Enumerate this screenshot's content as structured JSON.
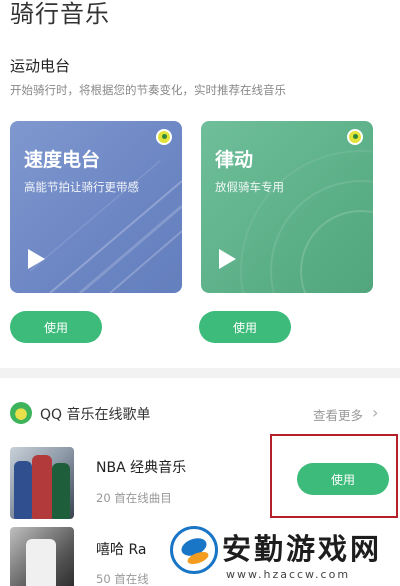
{
  "page": {
    "title": "骑行音乐"
  },
  "radio_section": {
    "title": "运动电台",
    "subtitle": "开始骑行时，将根据您的节奏变化，实时推荐在线音乐",
    "cards": [
      {
        "title": "速度电台",
        "subtitle": "高能节拍让骑行更带感",
        "button_label": "使用",
        "color": "#7189c6"
      },
      {
        "title": "律动",
        "subtitle": "放假骑车专用",
        "button_label": "使用",
        "color": "#5fb28b"
      }
    ]
  },
  "playlist_section": {
    "title": "QQ 音乐在线歌单",
    "more_label": "查看更多",
    "items": [
      {
        "title": "NBA 经典音乐",
        "subtitle": "20 首在线曲目",
        "button_label": "使用"
      },
      {
        "title": "嘻哈 Ra",
        "subtitle": "50 首在线"
      }
    ]
  },
  "watermark": {
    "text": "安勤游戏网",
    "url": "www.hzaccw.com"
  },
  "colors": {
    "accent": "#3dbb7a",
    "highlight": "#b3202a"
  }
}
